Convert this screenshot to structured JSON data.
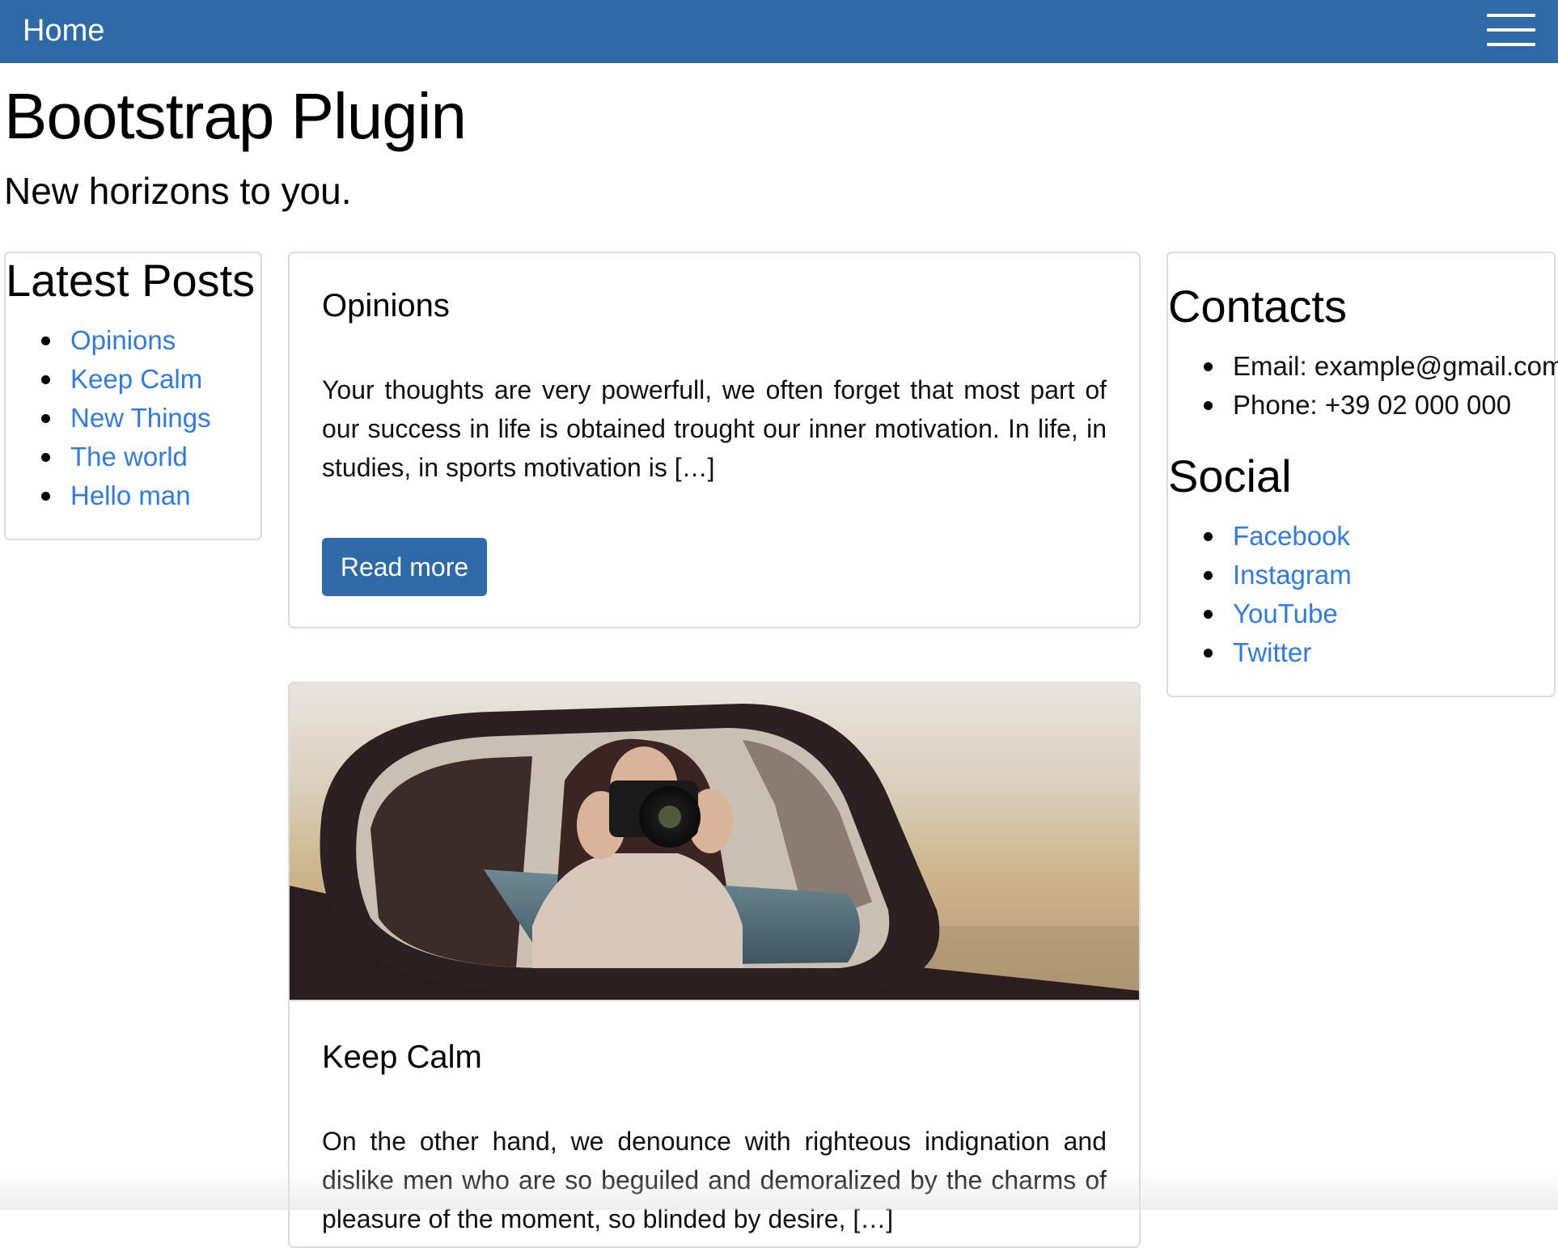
{
  "navbar": {
    "brand": "Home",
    "menu_icon": "hamburger-menu-icon",
    "color": "#2e6aa7"
  },
  "header": {
    "title": "Bootstrap Plugin",
    "subtitle": "New horizons to you."
  },
  "latest_posts": {
    "title": "Latest Posts",
    "items": [
      "Opinions",
      "Keep Calm",
      "New Things",
      "The world",
      "Hello man"
    ]
  },
  "posts": [
    {
      "title": "Opinions",
      "excerpt": "Your thoughts are very powerfull, we often forget that most part of our success in life is obtained trought our inner motivation. In life, in studies, in sports motivation is […]",
      "button": "Read more"
    },
    {
      "title": "Keep Calm",
      "excerpt": "On the other hand, we denounce with righteous indignation and dislike men who are so beguiled and demoralized by the charms of pleasure of the moment, so blinded by desire, […]",
      "image": "woman-photographing-in-car-side-mirror"
    }
  ],
  "contacts": {
    "title": "Contacts",
    "email": "Email: example@gmail.com",
    "phone": "Phone: +39 02 000 000"
  },
  "social": {
    "title": "Social",
    "items": [
      "Facebook",
      "Instagram",
      "YouTube",
      "Twitter"
    ]
  },
  "colors": {
    "primary": "#2e6aa7",
    "link": "#2f7ae5"
  }
}
